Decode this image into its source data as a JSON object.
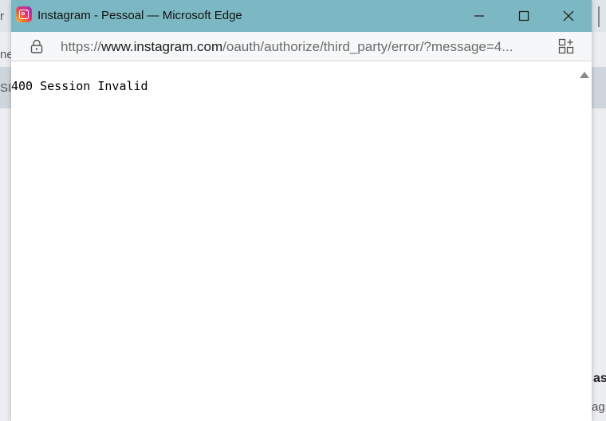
{
  "background": {
    "fragments": [
      "r",
      "ne",
      "SI",
      "as",
      "ag"
    ]
  },
  "window": {
    "title": "Instagram - Pessoal — Microsoft Edge",
    "icon": "instagram-icon",
    "controls": {
      "minimize": "minimize-icon",
      "maximize": "maximize-icon",
      "close": "close-icon"
    }
  },
  "address_bar": {
    "url_prefix": "https://",
    "url_host": "www.instagram.com",
    "url_path": "/oauth/authorize/third_party/error/?message=4...",
    "lock_icon": "lock-icon",
    "app_icon": "app-available-icon"
  },
  "page": {
    "error_message": "400 Session Invalid"
  },
  "colors": {
    "titlebar": "#7cb8c3",
    "address_bar": "#f6f7f8"
  }
}
